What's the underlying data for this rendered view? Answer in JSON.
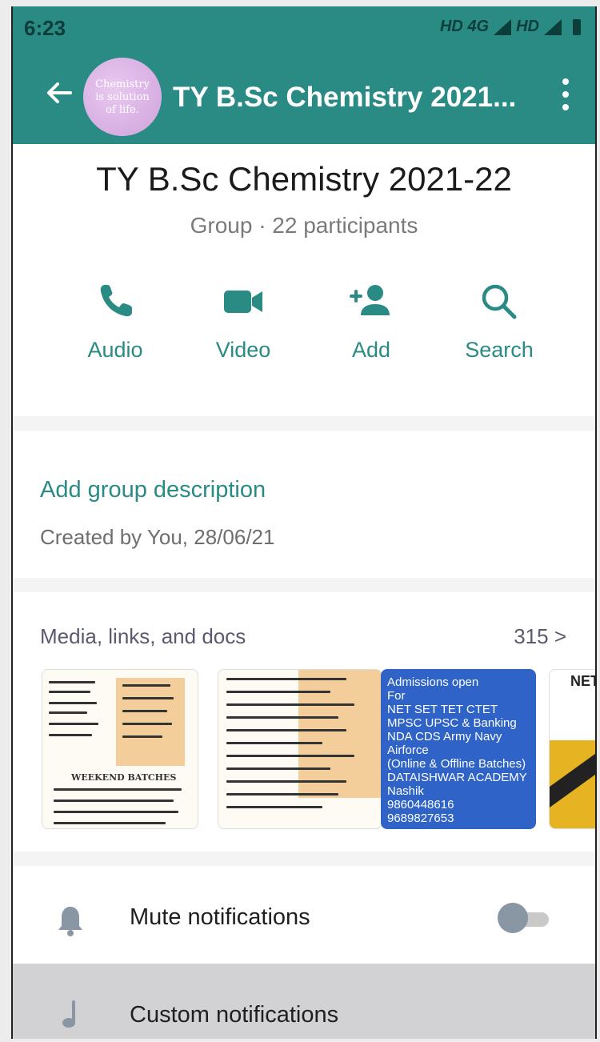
{
  "status_bar": {
    "time": "6:23",
    "network": "HD 4G",
    "network2": "HD"
  },
  "header": {
    "title": "TY B.Sc Chemistry 2021...",
    "avatar_text": [
      "Chemistry",
      "is solution",
      "of life."
    ]
  },
  "profile": {
    "name": "TY B.Sc Chemistry 2021-22",
    "meta": "Group · 22 participants",
    "actions": [
      {
        "label": "Audio",
        "icon": "phone-icon"
      },
      {
        "label": "Video",
        "icon": "video-camera-icon"
      },
      {
        "label": "Add",
        "icon": "add-person-icon"
      },
      {
        "label": "Search",
        "icon": "search-icon"
      }
    ]
  },
  "description": {
    "link": "Add group description",
    "created": "Created by You, 28/06/21"
  },
  "media": {
    "heading": "Media, links, and docs",
    "count": "315",
    "count_chevron": ">",
    "blue_thumb_lines": [
      "Admissions open",
      "For",
      "NET SET TET CTET",
      "MPSC UPSC & Banking",
      "NDA CDS Army Navy",
      "Airforce",
      "(Online & Offline Batches)",
      "DATAISHWAR ACADEMY",
      "Nashik",
      "9860448616",
      "9689827653"
    ],
    "net_thumb_text": "NET",
    "doc_thumb_heading": "WEEKEND BATCHES"
  },
  "settings": {
    "mute_label": "Mute notifications",
    "mute_on": false,
    "custom_label": "Custom notifications"
  },
  "colors": {
    "primary": "#2a8b85",
    "blue_card": "#2f63c8"
  }
}
